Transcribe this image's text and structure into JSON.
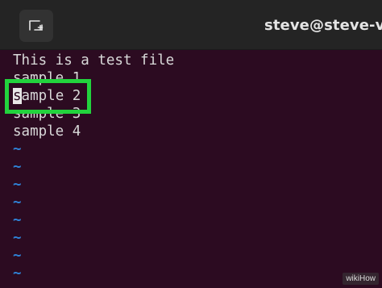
{
  "window": {
    "title": "steve@steve-vir",
    "new_tab_icon": "new-tab-icon"
  },
  "terminal": {
    "lines": [
      "This is a test file",
      "sample 1",
      "sample 2",
      "sample 3",
      "sample 4"
    ],
    "cursor_char": "s",
    "cursor_line_rest": "ample 2",
    "tilde": "~"
  },
  "colors": {
    "terminal_bg": "#2c0b21",
    "tilde": "#2f82d6",
    "highlight": "#22d33d"
  },
  "watermark": "wikiHow"
}
